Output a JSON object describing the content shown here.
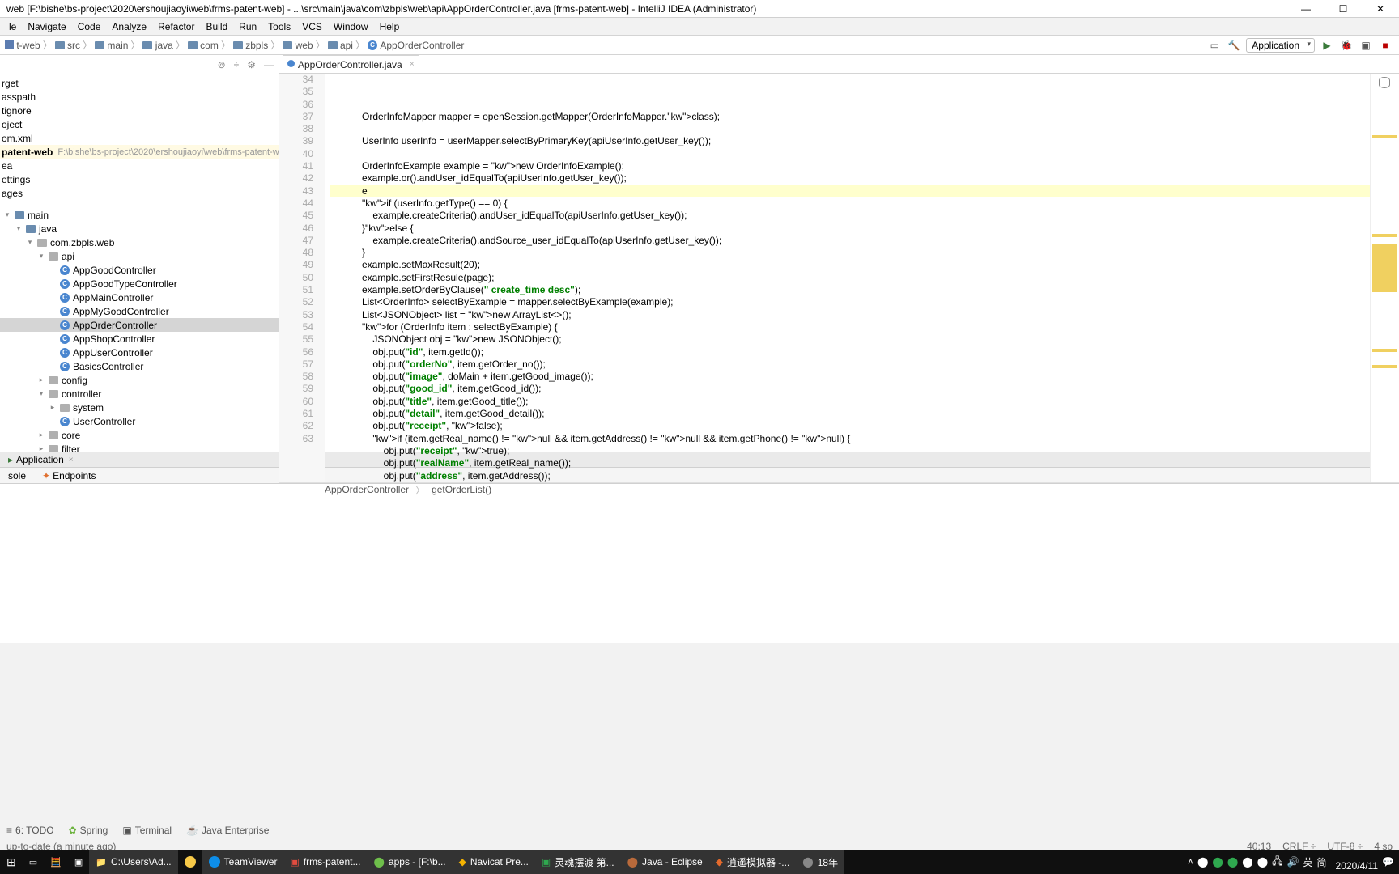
{
  "title": "web [F:\\bishe\\bs-project\\2020\\ershoujiaoyi\\web\\frms-patent-web] - ...\\src\\main\\java\\com\\zbpls\\web\\api\\AppOrderController.java [frms-patent-web] - IntelliJ IDEA (Administrator)",
  "menu": [
    "le",
    "Navigate",
    "Code",
    "Analyze",
    "Refactor",
    "Build",
    "Run",
    "Tools",
    "VCS",
    "Window",
    "Help"
  ],
  "breadcrumbs": [
    "t-web",
    "src",
    "main",
    "java",
    "com",
    "zbpls",
    "web",
    "api",
    "AppOrderController"
  ],
  "run_config": "Application",
  "project": {
    "items": [
      {
        "label": "rget",
        "indent": 0
      },
      {
        "label": "asspath",
        "indent": 0
      },
      {
        "label": "tignore",
        "indent": 0
      },
      {
        "label": "oject",
        "indent": 0
      },
      {
        "label": "om.xml",
        "indent": 0
      }
    ],
    "module": {
      "name": "patent-web",
      "path": "F:\\bishe\\bs-project\\2020\\ershoujiaoyi\\web\\frms-patent-web"
    },
    "post_module": [
      "ea",
      "ettings",
      "ages"
    ],
    "main_root": "main",
    "java_root": "java",
    "package": "com.zbpls.web",
    "api_pkg": "api",
    "api_classes": [
      "AppGoodController",
      "AppGoodTypeController",
      "AppMainController",
      "AppMyGoodController",
      "AppOrderController",
      "AppShopController",
      "AppUserController",
      "BasicsController"
    ],
    "config_pkg": "config",
    "controller_pkg": "controller",
    "system_pkg": "system",
    "user_controller": "UserController",
    "core_pkg": "core",
    "filter_pkg": "filter"
  },
  "editor": {
    "tab": "AppOrderController.java",
    "first_line": 34,
    "lines": [
      "            OrderInfoMapper mapper = openSession.getMapper(OrderInfoMapper.class);",
      "",
      "            UserInfo userInfo = userMapper.selectByPrimaryKey(apiUserInfo.getUser_key());",
      "",
      "            OrderInfoExample example = new OrderInfoExample();",
      "            example.or().andUser_idEqualTo(apiUserInfo.getUser_key());",
      "            e",
      "            if (userInfo.getType() == 0) {",
      "                example.createCriteria().andUser_idEqualTo(apiUserInfo.getUser_key());",
      "            }else {",
      "                example.createCriteria().andSource_user_idEqualTo(apiUserInfo.getUser_key());",
      "            }",
      "            example.setMaxResult(20);",
      "            example.setFirstResule(page);",
      "            example.setOrderByClause(\" create_time desc\");",
      "            List<OrderInfo> selectByExample = mapper.selectByExample(example);",
      "            List<JSONObject> list = new ArrayList<>();",
      "            for (OrderInfo item : selectByExample) {",
      "                JSONObject obj = new JSONObject();",
      "                obj.put(\"id\", item.getId());",
      "                obj.put(\"orderNo\", item.getOrder_no());",
      "                obj.put(\"image\", doMain + item.getGood_image());",
      "                obj.put(\"good_id\", item.getGood_id());",
      "                obj.put(\"title\", item.getGood_title());",
      "                obj.put(\"detail\", item.getGood_detail());",
      "                obj.put(\"receipt\", false);",
      "                if (item.getReal_name() != null && item.getAddress() != null && item.getPhone() != null) {",
      "                    obj.put(\"receipt\", true);",
      "                    obj.put(\"realName\", item.getReal_name());",
      "                    obj.put(\"address\", item.getAddress());"
    ],
    "highlight_index": 6,
    "breadcrumb": {
      "class": "AppOrderController",
      "method": "getOrderList()"
    }
  },
  "run_panel": {
    "config_tab": "Application",
    "subtabs": [
      "sole",
      "Endpoints"
    ]
  },
  "bottom_tools": [
    "6: TODO",
    "Spring",
    "Terminal",
    "Java Enterprise"
  ],
  "status": {
    "left": "up-to-date (a minute ago)",
    "pos": "40:13",
    "lineend": "CRLF",
    "encoding": "UTF-8",
    "indent": "4 sp"
  },
  "taskbar": {
    "items": [
      {
        "label": ""
      },
      {
        "label": ""
      },
      {
        "label": ""
      },
      {
        "label": ""
      },
      {
        "label": "C:\\Users\\Ad..."
      },
      {
        "label": ""
      },
      {
        "label": "TeamViewer"
      },
      {
        "label": "frms-patent..."
      },
      {
        "label": "apps - [F:\\b..."
      },
      {
        "label": "Navicat Pre..."
      },
      {
        "label": "灵魂摆渡 第..."
      },
      {
        "label": "Java - Eclipse"
      },
      {
        "label": "逍遥模拟器 -..."
      },
      {
        "label": "18年"
      }
    ],
    "time": "2020/4/11",
    "ime1": "英",
    "ime2": "简"
  }
}
